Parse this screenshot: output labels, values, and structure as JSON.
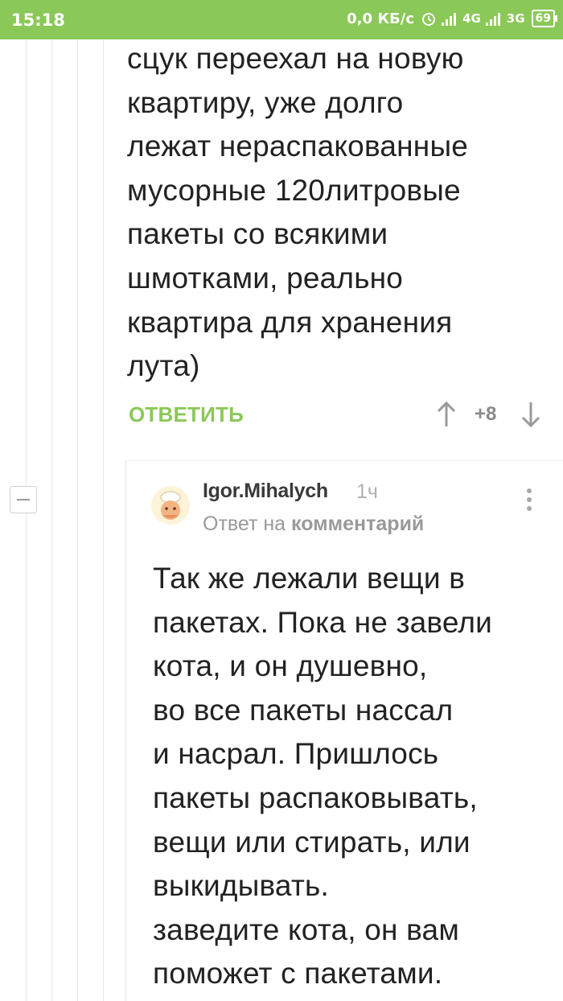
{
  "status_bar": {
    "time": "15:18",
    "net_speed": "0,0 КБ/с",
    "signal1_label": "4G",
    "signal2_label": "3G",
    "battery": "69"
  },
  "comment1": {
    "text": "сцук переехал на новую\nквартиру, уже долго\nлежат нераспакованные\nмусорные 120литровые\nпакеты со всякими\nшмотками, реально\nквартира для хранения\nлута)",
    "reply_label": "ОТВЕТИТЬ",
    "rating": "+8"
  },
  "comment2": {
    "author": "Igor.Mihalych",
    "time_ago": "1ч",
    "reply_to_prefix": "Ответ на",
    "reply_to_target": "комментарий",
    "text": "Так же лежали вещи в\nпакетах. Пока не завели\nкота, и он душевно,\nво все пакеты нассал\nи насрал. Пришлось\nпакеты распаковывать,\nвещи или стирать, или\nвыкидывать.\nзаведите кота, он вам\nпоможет с пакетами."
  },
  "colors": {
    "accent": "#8ac858",
    "text": "#222222",
    "muted": "#9a9a9a"
  }
}
